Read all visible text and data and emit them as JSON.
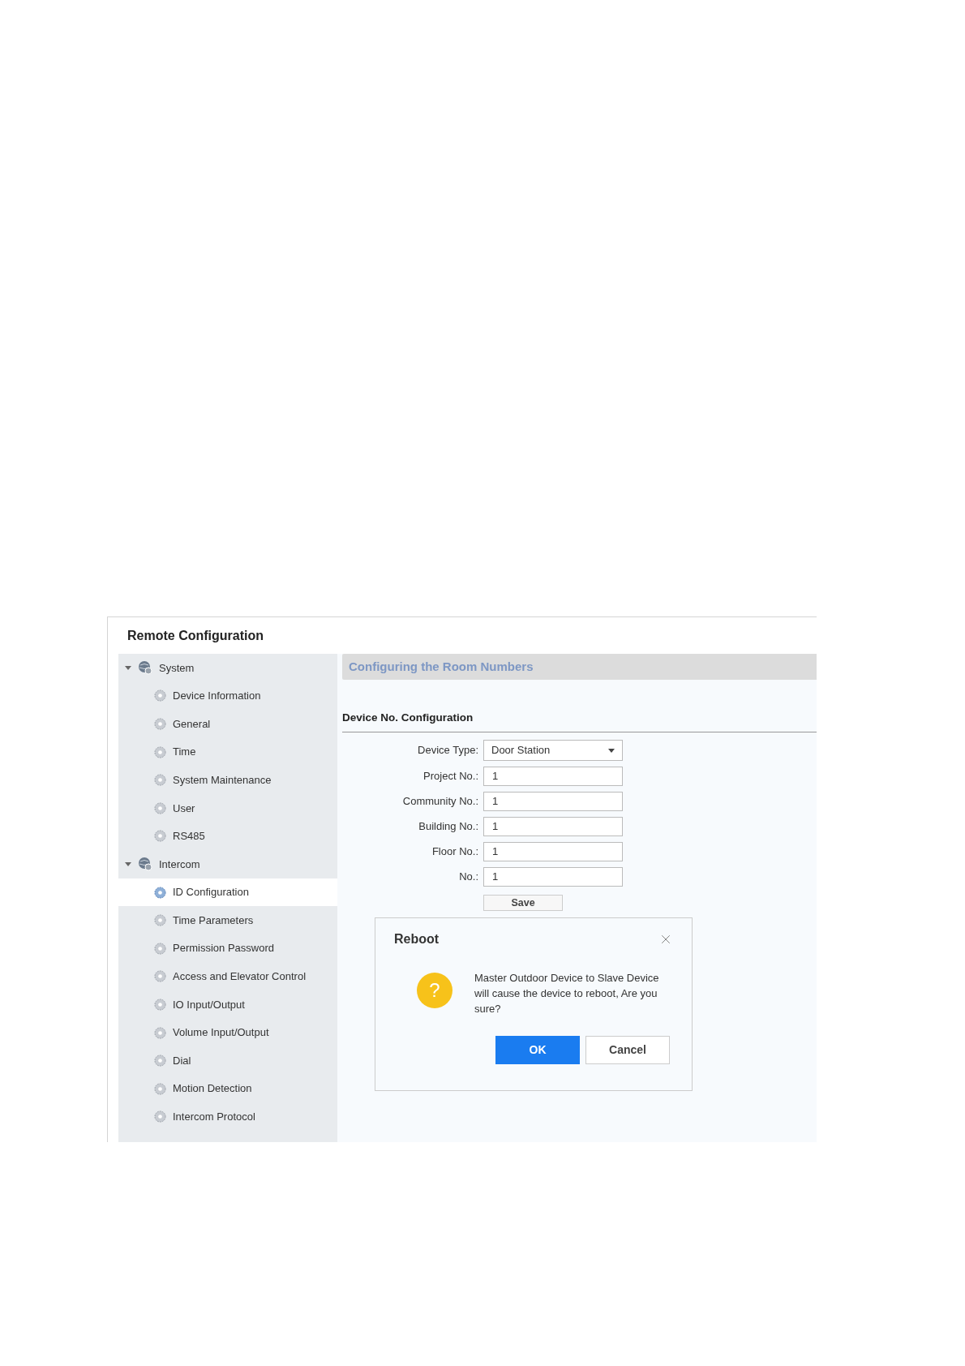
{
  "window": {
    "title": "Remote Configuration"
  },
  "sidebar": {
    "items": [
      {
        "label": "System",
        "expanded": true,
        "children": [
          {
            "label": "Device Information",
            "selected": false
          },
          {
            "label": "General",
            "selected": false
          },
          {
            "label": "Time",
            "selected": false
          },
          {
            "label": "System Maintenance",
            "selected": false
          },
          {
            "label": "User",
            "selected": false
          },
          {
            "label": "RS485",
            "selected": false
          }
        ]
      },
      {
        "label": "Intercom",
        "expanded": true,
        "children": [
          {
            "label": "ID Configuration",
            "selected": true
          },
          {
            "label": "Time Parameters",
            "selected": false
          },
          {
            "label": "Permission Password",
            "selected": false
          },
          {
            "label": "Access and Elevator Control",
            "selected": false
          },
          {
            "label": "IO Input/Output",
            "selected": false
          },
          {
            "label": "Volume Input/Output",
            "selected": false
          },
          {
            "label": "Dial",
            "selected": false
          },
          {
            "label": "Motion Detection",
            "selected": false
          },
          {
            "label": "Intercom Protocol",
            "selected": false
          }
        ]
      }
    ]
  },
  "panel": {
    "title": "Configuring the Room Numbers",
    "section": "Device No. Configuration",
    "fields": [
      {
        "kind": "select",
        "label": "Device Type:",
        "value": "Door Station"
      },
      {
        "kind": "text",
        "label": "Project No.:",
        "value": "1"
      },
      {
        "kind": "text",
        "label": "Community No.:",
        "value": "1"
      },
      {
        "kind": "text",
        "label": "Building No.:",
        "value": "1"
      },
      {
        "kind": "text",
        "label": "Floor No.:",
        "value": "1"
      },
      {
        "kind": "text",
        "label": "No.:",
        "value": "1"
      }
    ],
    "save_button": "Save"
  },
  "dialog": {
    "title": "Reboot",
    "icon_glyph": "?",
    "message": "Master Outdoor Device to Slave Device will cause the device to reboot, Are you sure?",
    "buttons": [
      {
        "label": "OK",
        "primary": true
      },
      {
        "label": "Cancel",
        "primary": false
      }
    ]
  }
}
